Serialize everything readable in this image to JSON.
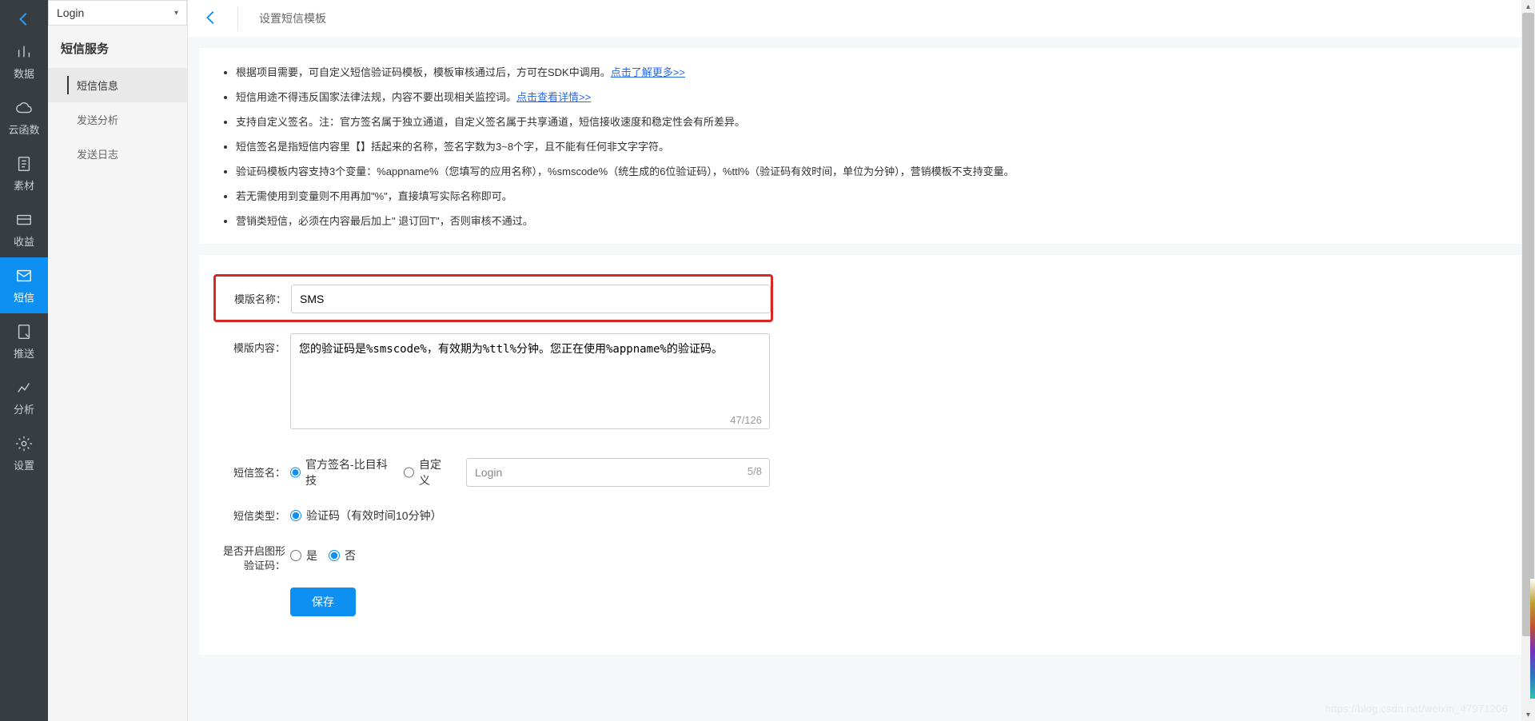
{
  "rail": {
    "items": [
      {
        "label": "数据",
        "name": "nav-data"
      },
      {
        "label": "云函数",
        "name": "nav-cloud-func"
      },
      {
        "label": "素材",
        "name": "nav-material"
      },
      {
        "label": "收益",
        "name": "nav-revenue"
      },
      {
        "label": "短信",
        "name": "nav-sms"
      },
      {
        "label": "推送",
        "name": "nav-push"
      },
      {
        "label": "分析",
        "name": "nav-analytics"
      },
      {
        "label": "设置",
        "name": "nav-settings"
      }
    ]
  },
  "sidebar": {
    "app_name": "Login",
    "section_title": "短信服务",
    "items": [
      {
        "label": "短信信息"
      },
      {
        "label": "发送分析"
      },
      {
        "label": "发送日志"
      }
    ]
  },
  "topbar": {
    "title": "设置短信模板"
  },
  "notes": {
    "n1_a": "根据项目需要，可自定义短信验证码模板，模板审核通过后，方可在SDK中调用。",
    "n1_link": "点击了解更多>>",
    "n2_a": "短信用途不得违反国家法律法规，内容不要出现相关监控词。",
    "n2_link": "点击查看详情>>",
    "n3": "支持自定义签名。注：官方签名属于独立通道，自定义签名属于共享通道，短信接收速度和稳定性会有所差异。",
    "n4": "短信签名是指短信内容里【】括起来的名称，签名字数为3~8个字，且不能有任何非文字字符。",
    "n5": "验证码模板内容支持3个变量：%appname%（您填写的应用名称），%smscode%（统生成的6位验证码），%ttl%（验证码有效时间，单位为分钟），营销模板不支持变量。",
    "n6": "若无需使用到变量则不用再加\"%\"，直接填写实际名称即可。",
    "n7": "营销类短信，必须在内容最后加上\" 退订回T\"，否则审核不通过。"
  },
  "form": {
    "name_label": "模版名称：",
    "name_value": "SMS",
    "content_label": "模版内容：",
    "content_value": "您的验证码是%smscode%，有效期为%ttl%分钟。您正在使用%appname%的验证码。",
    "content_counter": "47/126",
    "signature_label": "短信签名：",
    "signature_opt1": "官方签名-比目科技",
    "signature_opt2": "自定义",
    "signature_value": "Login",
    "signature_counter": "5/8",
    "type_label": "短信类型：",
    "type_opt1": "验证码（有效时间10分钟）",
    "captcha_label": "是否开启图形验证码：",
    "captcha_yes": "是",
    "captcha_no": "否",
    "save_label": "保存"
  },
  "watermark": "https://blog.csdn.net/weixin_47971206"
}
